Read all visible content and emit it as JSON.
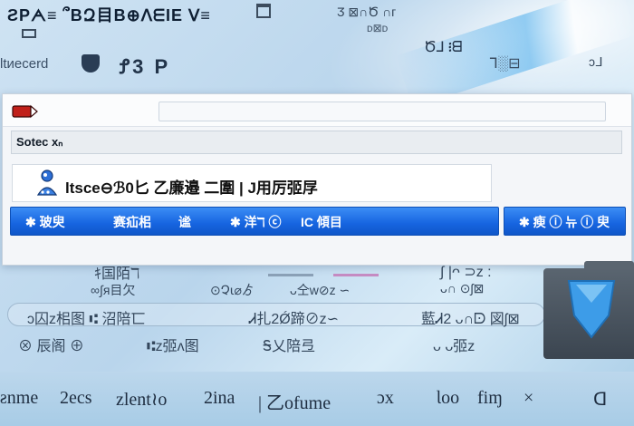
{
  "header": {
    "title": "ƧPᗅ≡ ՞BԶ目B⊕ᐱᗴIE ᐯ≡",
    "top_right": "Ӡ ⊠∩Ծ ∩ᴦ",
    "row2_label": "ᴅ⊠ᴅ",
    "row3_left": "ltᴎecerd",
    "row3_mid": "Ꝭ3 P",
    "row3_num": "Ծ⅃ ᎒ᗺ",
    "row3_pane": "ᒣ░⊟",
    "row3_right": "ɔᒧ"
  },
  "dialog": {
    "search_value": "Sotec xₙ",
    "result_text": "ltsce⊖ℬ0匕 乙廉邉 二圍 | J用厉弬㞌",
    "actions": [
      "✱ 玻臾",
      "赛疝㭒",
      "谧 ",
      "✱ 洋ℸ ⓒ",
      "IC 傾目"
    ],
    "action_right": "✱ 瘐 ⓘ 뉴 ⓘ 臾"
  },
  "background": {
    "row1": [
      "ｷ国陌ℸ",
      "∫ |ᴖ ⊃ᴢ :"
    ],
    "row2": [
      "∞∫ᴙ目欠",
      "⊙Չ⍳⌀ゟ",
      "ᴗ仝ᴡ⊘ᴢ ∽",
      "ᴗ∩ ⊙ʃ⊠"
    ],
    "pill": [
      "ᴐ囚ᴢ㭒图 ⑆ 沼陪匸",
      "Ꮧ扎2Ǿ蹄⊘ᴢ∽",
      "藍Ꮧ2 ᴗ∩ᗠ 図ʃ⊠"
    ],
    "row4": [
      "⊗ 辰阁 ⊕",
      "⑆ᴢ弬ᴧ图",
      "Ꭶ乂陪弖",
      "ᴗ ᴗ弬ᴢ"
    ],
    "bottom": [
      "ƨnme",
      "2ecs",
      "ᴢlent≀o",
      "2ina",
      "| 乙ofume",
      "ɔx",
      "Ɩoo",
      "fiɱ",
      "×",
      "ᗡ"
    ]
  },
  "colors": {
    "accent": "#1664e0",
    "background": "#b9d5ec",
    "dialog": "#f4f6f9",
    "tag_red": "#c0201a"
  }
}
